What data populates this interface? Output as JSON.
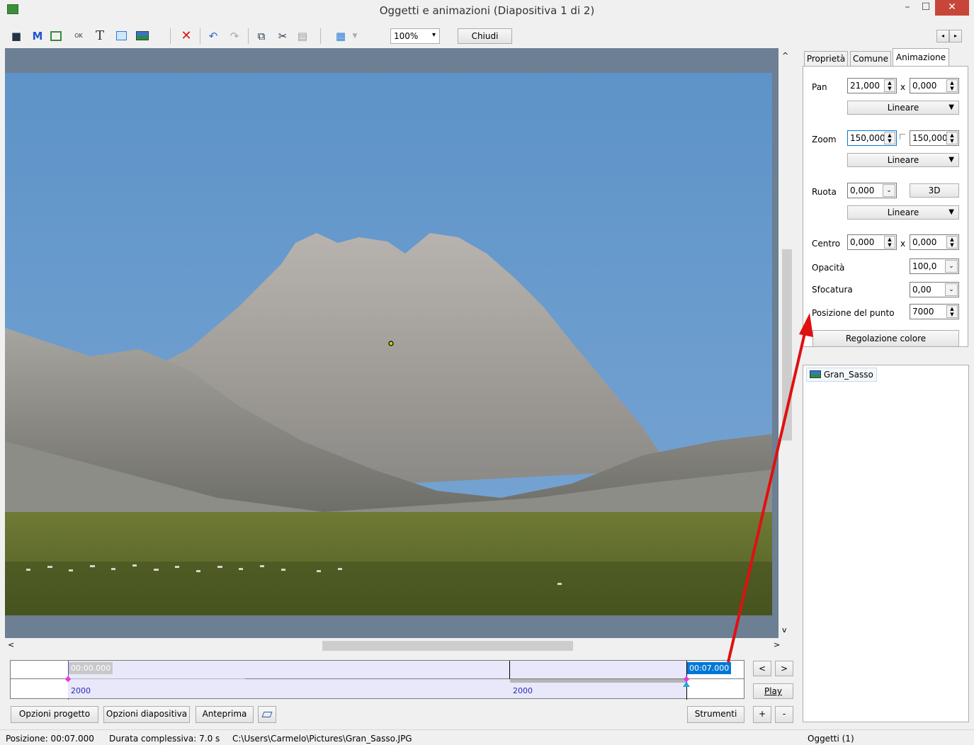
{
  "window": {
    "title": "Oggetti e animazioni  (Diapositiva 1 di 2)",
    "close_glyph": "✕",
    "minimize_glyph": "–",
    "maximize_glyph": "☐"
  },
  "toolbar": {
    "zoom_value": "100%",
    "close_label": "Chiudi",
    "icons": [
      "camera-icon",
      "mask-icon",
      "frame-icon",
      "button-icon",
      "text-icon",
      "rectangle-icon",
      "image-icon",
      "delete-icon",
      "undo-icon",
      "redo-icon",
      "copy-icon",
      "cut-icon",
      "paste-icon",
      "grid-icon"
    ],
    "m_glyph": "M",
    "t_glyph": "T",
    "ok_glyph": "OK"
  },
  "tabs": [
    "Proprietà",
    "Comune",
    "Animazione"
  ],
  "animation": {
    "pan_label": "Pan",
    "pan_x": "21,000",
    "pan_sep": "x",
    "pan_y": "0,000",
    "pan_mode": "Lineare",
    "zoom_label": "Zoom",
    "zoom_x": "150,000",
    "zoom_y": "150,000",
    "zoom_mode": "Lineare",
    "rotate_label": "Ruota",
    "rotate_value": "0,000",
    "rotate_3d": "3D",
    "rotate_mode": "Lineare",
    "center_label": "Centro",
    "center_x": "0,000",
    "center_sep": "x",
    "center_y": "0,000",
    "opacity_label": "Opacità",
    "opacity_value": "100,0",
    "blur_label": "Sfocatura",
    "blur_value": "0,00",
    "keypos_label": "Posizione del punto",
    "keypos_value": "7000",
    "color_button": "Regolazione colore"
  },
  "objects": {
    "items": [
      "Gran_Sasso"
    ]
  },
  "timeline": {
    "start_time": "00:00.000",
    "end_time": "00:07.000",
    "row2_left": "2000",
    "row2_mid": "2000",
    "prev": "<",
    "next": ">",
    "play": "Play",
    "plus": "+",
    "minus": "-"
  },
  "bottom_buttons": {
    "project_options": "Opzioni progetto",
    "slide_options": "Opzioni diapositiva",
    "preview": "Anteprima",
    "tools": "Strumenti"
  },
  "status": {
    "position": "Posizione:  00:07.000",
    "duration": "Durata complessiva:  7.0 s",
    "path": "C:\\Users\\Carmelo\\Pictures\\Gran_Sasso.JPG",
    "objects_count": "Oggetti (1)"
  },
  "scroll": {
    "up": "^",
    "down": "v",
    "left": "<",
    "right": ">"
  },
  "colors": {
    "accent": "#0078d7",
    "annotation_arrow": "#e01010",
    "close_red": "#c7463a"
  }
}
